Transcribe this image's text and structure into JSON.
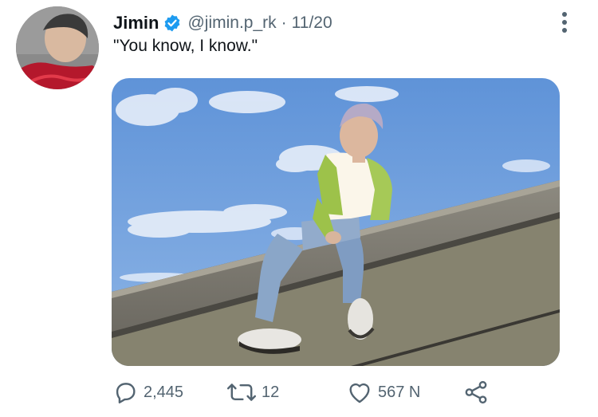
{
  "tweet": {
    "author_name": "Jimin",
    "handle": "@jimin.p_rk",
    "separator": "·",
    "date": "11/20",
    "text": "\"You know, I know.\"",
    "verified_icon": "verified-badge-icon",
    "more_icon": "more-vertical-icon"
  },
  "actions": {
    "replies": "2,445",
    "retweets": "12",
    "likes": "567 N",
    "icons": [
      "reply-icon",
      "retweet-icon",
      "like-icon",
      "share-icon"
    ]
  },
  "colors": {
    "text": "#0f1419",
    "secondary": "#536471",
    "verified": "#1d9bf0",
    "sky": "#6f9fdd"
  }
}
